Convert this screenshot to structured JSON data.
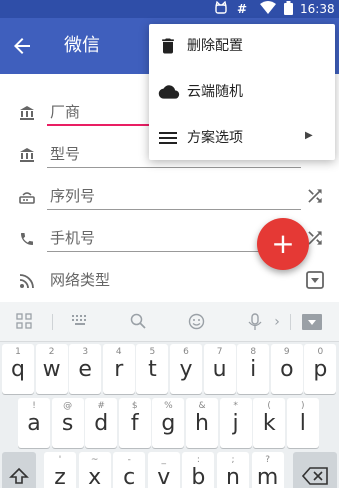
{
  "status": {
    "time": "16:38",
    "icons": [
      "cat-icon",
      "hash-icon",
      "wifi-icon",
      "battery-icon"
    ]
  },
  "appbar": {
    "title": "微信",
    "back_icon": "arrow-back-icon"
  },
  "menu": {
    "items": [
      {
        "label": "删除配置",
        "icon": "trash-icon"
      },
      {
        "label": "云端随机",
        "icon": "cloud-icon"
      },
      {
        "label": "方案选项",
        "icon": "menu-lines-icon",
        "has_submenu": true
      }
    ]
  },
  "form": {
    "rows": [
      {
        "icon": "bank-icon",
        "value": "厂商",
        "focused": true
      },
      {
        "icon": "bank-icon",
        "value": "型号"
      },
      {
        "icon": "router-icon",
        "value": "序列号",
        "action_icon": "shuffle-icon"
      },
      {
        "icon": "phone-icon",
        "value": "手机号",
        "action_icon": "shuffle-icon"
      },
      {
        "icon": "rss-icon",
        "value": "网络类型",
        "action_icon": "dropdown-box-icon"
      }
    ]
  },
  "fab": {
    "label": "+",
    "icon": "add-icon"
  },
  "keyboard": {
    "suggestion_icons": [
      "grid-icon",
      "keyboard-icon",
      "search-icon",
      "emoji-icon",
      "mic-icon",
      "chevron-right-icon",
      "hide-keyboard-icon"
    ],
    "row1": [
      {
        "ch": "q",
        "hint": "1"
      },
      {
        "ch": "w",
        "hint": "2"
      },
      {
        "ch": "e",
        "hint": "3"
      },
      {
        "ch": "r",
        "hint": "4"
      },
      {
        "ch": "t",
        "hint": "5"
      },
      {
        "ch": "y",
        "hint": "6"
      },
      {
        "ch": "u",
        "hint": "7"
      },
      {
        "ch": "i",
        "hint": "8"
      },
      {
        "ch": "o",
        "hint": "9"
      },
      {
        "ch": "p",
        "hint": "0"
      }
    ],
    "row2": [
      {
        "ch": "a",
        "hint": "!"
      },
      {
        "ch": "s",
        "hint": "@"
      },
      {
        "ch": "d",
        "hint": "#"
      },
      {
        "ch": "f",
        "hint": "$"
      },
      {
        "ch": "g",
        "hint": "%"
      },
      {
        "ch": "h",
        "hint": "&"
      },
      {
        "ch": "j",
        "hint": "*"
      },
      {
        "ch": "k",
        "hint": "("
      },
      {
        "ch": "l",
        "hint": ")"
      }
    ],
    "row3": [
      {
        "ch": "z",
        "hint": "'"
      },
      {
        "ch": "x",
        "hint": "~"
      },
      {
        "ch": "c",
        "hint": "-"
      },
      {
        "ch": "v",
        "hint": "_"
      },
      {
        "ch": "b",
        "hint": ":"
      },
      {
        "ch": "n",
        "hint": ";"
      },
      {
        "ch": "m",
        "hint": "?"
      }
    ],
    "shift_icon": "shift-icon",
    "backspace_icon": "backspace-icon"
  },
  "colors": {
    "primary": "#3f5fbd",
    "status": "#2f4ea8",
    "accent": "#e53935",
    "focus_line": "#e91e63"
  }
}
